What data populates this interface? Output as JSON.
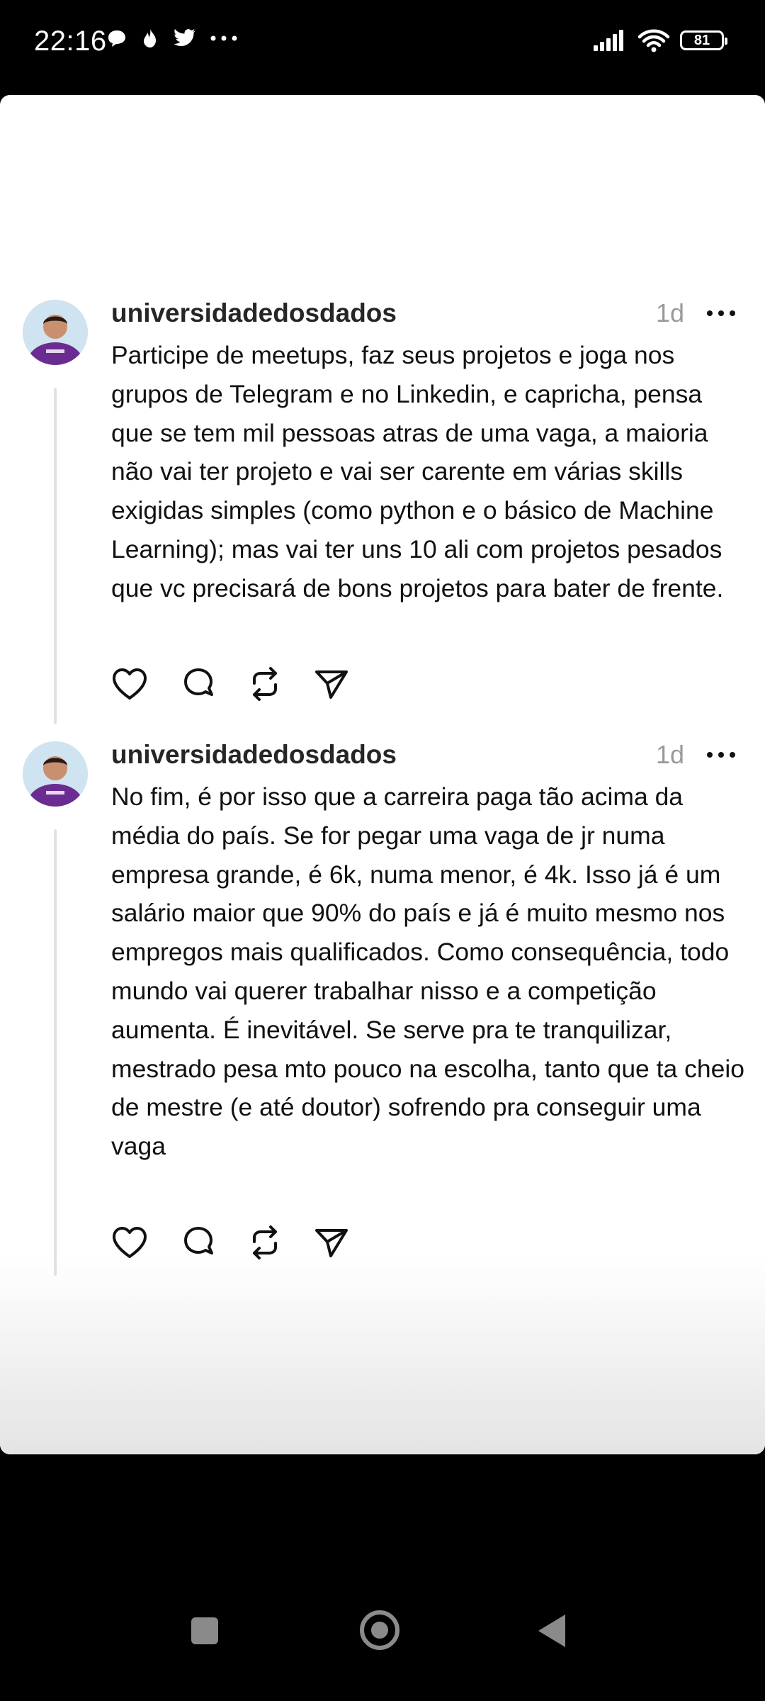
{
  "status_bar": {
    "time": "22:16",
    "battery": "81",
    "left_icons": [
      "chat-bubble-icon",
      "flame-icon",
      "twitter-bird-icon",
      "more-dots-icon"
    ],
    "right_icons": [
      "signal-icon",
      "wifi-icon",
      "battery-icon"
    ]
  },
  "posts": [
    {
      "username": "universidadedosdados",
      "time": "1d",
      "text": "Participe de meetups, faz seus projetos e joga nos grupos de Telegram e no Linkedin, e capricha, pensa que se tem mil pessoas atras de uma vaga, a maioria não vai ter projeto e vai ser carente em várias skills exigidas simples (como python e o básico de Machine Learning); mas vai ter uns 10 ali com projetos pesados que vc precisará de bons projetos para bater de frente.",
      "actions": [
        "heart-icon",
        "comment-icon",
        "repost-icon",
        "share-icon"
      ]
    },
    {
      "username": "universidadedosdados",
      "time": "1d",
      "text": "No fim, é por isso que a carreira paga tão acima da média do país. Se for pegar uma vaga de jr numa empresa grande, é 6k, numa menor, é 4k. Isso já é um salário maior que 90% do país e já é muito mesmo nos empregos mais qualificados. Como consequência, todo mundo vai querer trabalhar nisso e a competição aumenta. É inevitável. Se serve pra te tranquilizar, mestrado pesa mto pouco na escolha, tanto que ta cheio de mestre (e até doutor) sofrendo pra conseguir uma vaga",
      "actions": [
        "heart-icon",
        "comment-icon",
        "repost-icon",
        "share-icon"
      ]
    }
  ],
  "nav_bar": {
    "buttons": [
      "recents-square-icon",
      "home-circle-icon",
      "back-triangle-icon"
    ]
  }
}
